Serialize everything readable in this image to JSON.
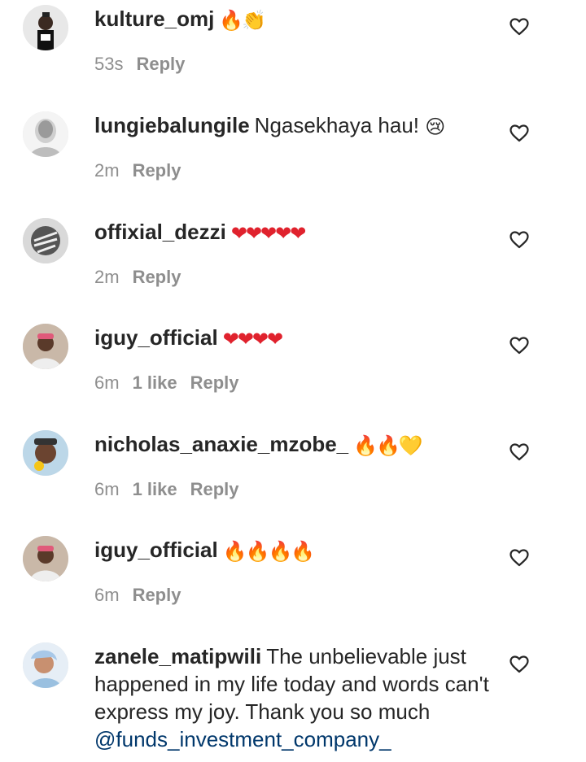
{
  "comments": [
    {
      "user": "kulture_omj",
      "text": "",
      "emoji": "🔥👏",
      "time": "53s",
      "likes": "",
      "reply": "Reply"
    },
    {
      "user": "lungiebalungile",
      "text": "Ngasekhaya hau!",
      "emoji": "😢",
      "time": "2m",
      "likes": "",
      "reply": "Reply"
    },
    {
      "user": "offixial_dezzi",
      "text": "",
      "emoji": "❤❤❤❤❤",
      "time": "2m",
      "likes": "",
      "reply": "Reply"
    },
    {
      "user": "iguy_official",
      "text": "",
      "emoji": "❤❤❤❤",
      "time": "6m",
      "likes": "1 like",
      "reply": "Reply"
    },
    {
      "user": "nicholas_anaxie_mzobe_",
      "text": "",
      "emoji": "🔥🔥💛",
      "time": "6m",
      "likes": "1 like",
      "reply": "Reply"
    },
    {
      "user": "iguy_official",
      "text": "",
      "emoji": "🔥🔥🔥🔥",
      "time": "6m",
      "likes": "",
      "reply": "Reply"
    },
    {
      "user": "zanele_matipwili",
      "text": "The unbelievable just happened in my life today and words can't express my joy. Thank you so much",
      "mention": "@funds_investment_company_",
      "emoji": "",
      "time": "",
      "likes": "",
      "reply": ""
    }
  ],
  "icons": {
    "like": "heart-outline-icon"
  },
  "colors": {
    "text": "#262626",
    "meta": "#8e8e8e",
    "mention": "#00376b"
  }
}
